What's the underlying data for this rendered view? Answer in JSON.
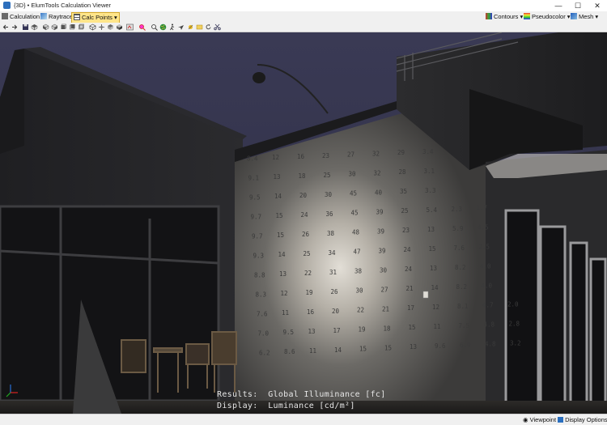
{
  "window": {
    "title": "{3D} • ElumTools Calculation Viewer",
    "minimize_glyph": "—",
    "maximize_glyph": "☐",
    "close_glyph": "✕"
  },
  "toolbar": {
    "calculation_label": "Calculation",
    "raytrace_label": "Raytrace",
    "calc_points_label": "Calc Points",
    "contours_label": "Contours",
    "pseudocolor_label": "Pseudocolor",
    "mesh_label": "Mesh"
  },
  "icons": {
    "toolbar1": [
      "calculation-icon",
      "raytrace-icon",
      "calc-points-icon",
      "contours-icon",
      "pseudocolor-icon",
      "mesh-icon"
    ],
    "toolbar2": [
      "back-arrow-icon",
      "forward-arrow-icon",
      "save-icon",
      "view-top-icon",
      "view-front-icon",
      "view-right-icon",
      "view-left-icon",
      "view-back-icon",
      "view-bottom-icon",
      "orbit-icon",
      "pan-icon",
      "rotate-icon",
      "zoom-extents-icon",
      "zoom-icon",
      "walk-icon",
      "look-icon",
      "fly-icon",
      "sun-icon",
      "refresh-icon",
      "measure-icon",
      "scissors-icon",
      "globe-icon",
      "person-icon"
    ]
  },
  "scene": {
    "results_line": "Results:  Global Illuminance [fc]",
    "display_line": "Display:  Luminance [cd/m²]",
    "calc_point_values": [
      [
        "8.4",
        "12",
        "16",
        "23",
        "27",
        "32",
        "29",
        "3.4"
      ],
      [
        "9.1",
        "13",
        "18",
        "25",
        "30",
        "32",
        "28",
        "3.1"
      ],
      [
        "9.5",
        "14",
        "20",
        "30",
        "45",
        "40",
        "35",
        "3.3"
      ],
      [
        "9.7",
        "15",
        "24",
        "36",
        "45",
        "39",
        "25",
        "5.4",
        "2.3",
        "1.7"
      ],
      [
        "9.7",
        "15",
        "26",
        "38",
        "48",
        "39",
        "23",
        "13",
        "5.9",
        "4.5"
      ],
      [
        "9.3",
        "14",
        "25",
        "34",
        "47",
        "39",
        "24",
        "15",
        "7.6",
        "2.5"
      ],
      [
        "8.8",
        "13",
        "22",
        "31",
        "38",
        "30",
        "24",
        "13",
        "8.2",
        "4.0"
      ],
      [
        "8.3",
        "12",
        "19",
        "26",
        "30",
        "27",
        "21",
        "14",
        "8.2",
        "4.0"
      ],
      [
        "7.6",
        "11",
        "16",
        "20",
        "22",
        "21",
        "17",
        "12",
        "8.1",
        "4.7",
        "2.0"
      ],
      [
        "7.0",
        "9.5",
        "13",
        "17",
        "19",
        "18",
        "15",
        "11",
        "7.5",
        "4.8",
        "2.8"
      ],
      [
        "6.2",
        "8.6",
        "11",
        "14",
        "15",
        "15",
        "13",
        "9.6",
        "6.9",
        "4.8",
        "3.2"
      ]
    ]
  },
  "statusbar": {
    "viewpoint_label": "Viewpoint",
    "display_options_label": "Display Options"
  },
  "colors": {
    "sky": "#37374d",
    "wall_lit": "#c9c4bb",
    "accent_highlight": "#ffe58a"
  }
}
